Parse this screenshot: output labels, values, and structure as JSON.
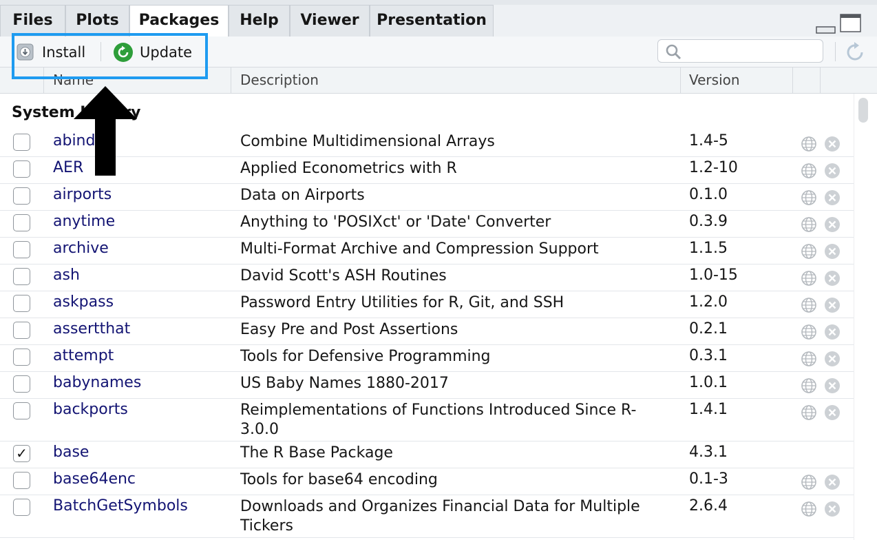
{
  "tabs": [
    {
      "label": "Files"
    },
    {
      "label": "Plots"
    },
    {
      "label": "Packages"
    },
    {
      "label": "Help"
    },
    {
      "label": "Viewer"
    },
    {
      "label": "Presentation"
    }
  ],
  "active_tab": "Packages",
  "toolbar": {
    "install_label": "Install",
    "update_label": "Update",
    "search_placeholder": "",
    "search_value": ""
  },
  "table": {
    "columns": {
      "name": "Name",
      "description": "Description",
      "version": "Version"
    },
    "section_title": "System Library",
    "rows": [
      {
        "name": "abind",
        "description": "Combine Multidimensional Arrays",
        "version": "1.4-5",
        "checked": false
      },
      {
        "name": "AER",
        "description": "Applied Econometrics with R",
        "version": "1.2-10",
        "checked": false
      },
      {
        "name": "airports",
        "description": "Data on Airports",
        "version": "0.1.0",
        "checked": false
      },
      {
        "name": "anytime",
        "description": "Anything to 'POSIXct' or 'Date' Converter",
        "version": "0.3.9",
        "checked": false
      },
      {
        "name": "archive",
        "description": "Multi-Format Archive and Compression Support",
        "version": "1.1.5",
        "checked": false
      },
      {
        "name": "ash",
        "description": "David Scott's ASH Routines",
        "version": "1.0-15",
        "checked": false
      },
      {
        "name": "askpass",
        "description": "Password Entry Utilities for R, Git, and SSH",
        "version": "1.2.0",
        "checked": false
      },
      {
        "name": "assertthat",
        "description": "Easy Pre and Post Assertions",
        "version": "0.2.1",
        "checked": false
      },
      {
        "name": "attempt",
        "description": "Tools for Defensive Programming",
        "version": "0.3.1",
        "checked": false
      },
      {
        "name": "babynames",
        "description": "US Baby Names 1880-2017",
        "version": "1.0.1",
        "checked": false
      },
      {
        "name": "backports",
        "description": "Reimplementations of Functions Introduced Since R-3.0.0",
        "version": "1.4.1",
        "checked": false
      },
      {
        "name": "base",
        "description": "The R Base Package",
        "version": "4.3.1",
        "checked": true
      },
      {
        "name": "base64enc",
        "description": "Tools for base64 encoding",
        "version": "0.1-3",
        "checked": false
      },
      {
        "name": "BatchGetSymbols",
        "description": "Downloads and Organizes Financial Data for Multiple Tickers",
        "version": "2.6.4",
        "checked": false
      }
    ]
  },
  "row_actions": {
    "website_icon": "globe-icon",
    "remove_icon": "remove-x-icon"
  },
  "colors": {
    "highlight": "#1e9bf0",
    "link": "#131473",
    "update_green": "#2e9e3a"
  }
}
